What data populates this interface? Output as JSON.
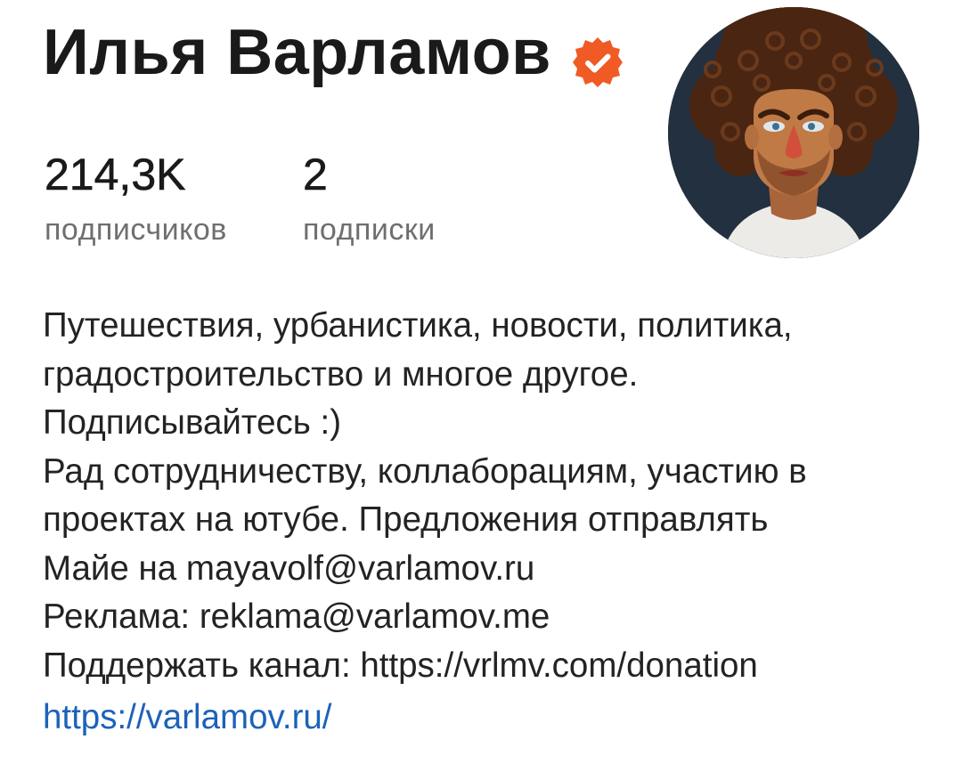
{
  "profile": {
    "name": "Илья Варламов",
    "verified_icon": "verified-badge-icon",
    "verified_color": "#f05a24",
    "avatar_icon": "avatar-illustration"
  },
  "stats": {
    "followers_value": "214,3K",
    "followers_label": "подписчиков",
    "following_value": "2",
    "following_label": "подписки"
  },
  "bio": {
    "lines": [
      "Путешествия, урбанистика, новости, политика,",
      "градостроительство и многое другое.",
      "Подписывайтесь :)",
      "Рад сотрудничеству, коллаборациям, участию в",
      "проектах на ютубе. Предложения отправлять",
      "Майе на mayavolf@varlamov.ru",
      "Реклама: reklama@varlamov.me",
      "Поддержать канал: https://vrlmv.com/donation"
    ]
  },
  "link": {
    "text": "https://varlamov.ru/",
    "color": "#1c62b9"
  }
}
